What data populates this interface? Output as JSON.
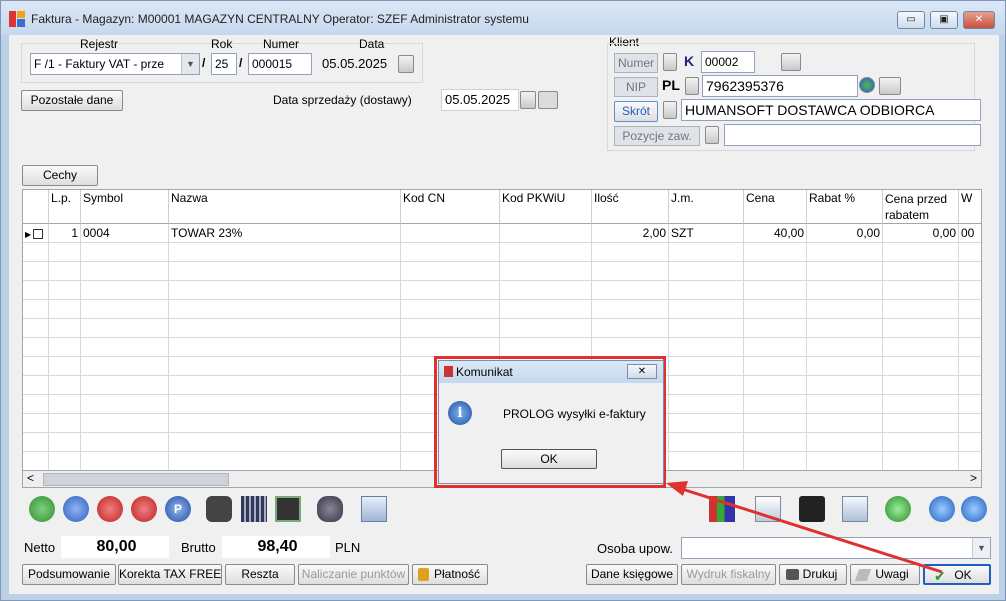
{
  "window": {
    "title": "Faktura - Magazyn: M00001 MAGAZYN CENTRALNY  Operator: SZEF Administrator systemu",
    "minimize": "▭",
    "maximize": "▣",
    "close": "✕"
  },
  "header": {
    "rejestr_label": "Rejestr",
    "rok_label": "Rok",
    "numer_label": "Numer",
    "data_label": "Data",
    "rejestr_value": "F /1   - Faktury VAT - prze",
    "separator": "/",
    "rok_value": "25",
    "numer_value": "000015",
    "data_value": "05.05.2025",
    "pozostale_button": "Pozostałe dane",
    "data_sprzedazy_label": "Data sprzedaży (dostawy)",
    "data_sprzedazy_value": "05.05.2025"
  },
  "client": {
    "section_label": "Klient",
    "numer_label": "Numer",
    "numer_prefix": "K",
    "numer_value": "00002",
    "nip_label": "NIP",
    "nip_prefix": "PL",
    "nip_value": "7962395376",
    "skrot_label": "Skrót",
    "skrot_value": "HUMANSOFT DOSTAWCA ODBIORCA",
    "pozycje_label": "Pozycje zaw.",
    "pozycje_value": ""
  },
  "cechy_button": "Cechy",
  "grid": {
    "columns": [
      "L.p.",
      "Symbol",
      "Nazwa",
      "Kod CN",
      "Kod PKWiU",
      "Ilość",
      "J.m.",
      "Cena",
      "Rabat %",
      "Cena przed rabatem",
      "W"
    ],
    "rows": [
      [
        "1",
        "0004",
        "TOWAR 23%",
        "",
        "",
        "2,00",
        "SZT",
        "40,00",
        "0,00",
        "0,00",
        "00"
      ]
    ]
  },
  "scroll": {
    "left": "<",
    "right": ">"
  },
  "totals": {
    "netto_label": "Netto",
    "netto_value": "80,00",
    "brutto_label": "Brutto",
    "brutto_value": "98,40",
    "currency": "PLN",
    "osoba_label": "Osoba upow.",
    "osoba_value": ""
  },
  "bottom_buttons": {
    "podsumowanie": "Podsumowanie",
    "korekta": "Korekta TAX FREE",
    "reszta": "Reszta",
    "naliczanie": "Naliczanie punktów",
    "platnosc": "Płatność",
    "dane_ksiegowe": "Dane księgowe",
    "wydruk": "Wydruk fiskalny",
    "drukuj": "Drukuj",
    "uwagi": "Uwagi",
    "ok": "OK"
  },
  "dialog": {
    "title": "Komunikat",
    "message": "PROLOG wysyłki e-faktury",
    "ok": "OK"
  },
  "colors": {
    "highlight": "#e03030",
    "accent_blue": "#1f5fbf"
  }
}
